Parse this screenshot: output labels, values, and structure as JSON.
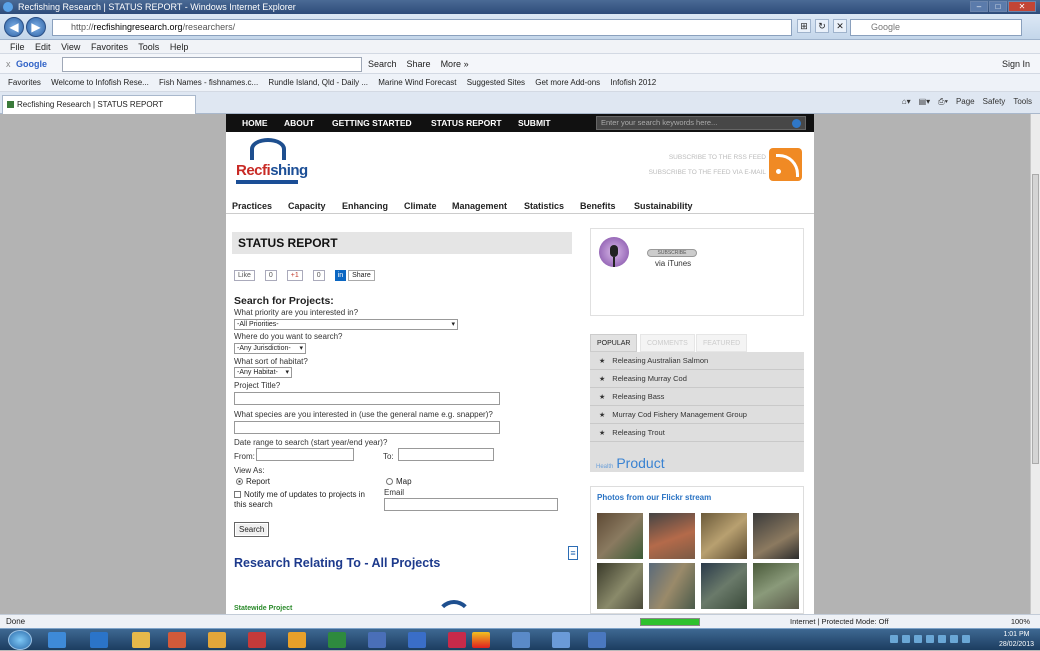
{
  "browser": {
    "title": "Recfishing Research | STATUS REPORT - Windows Internet Explorer",
    "address_prefix": "http://",
    "address_domain": "recfishingresearch.org",
    "address_path": "/researchers/",
    "google_search_placeholder": "Google",
    "menu": [
      "File",
      "Edit",
      "View",
      "Favorites",
      "Tools",
      "Help"
    ],
    "google_toolbar": {
      "close": "x",
      "logo": "Google",
      "items": [
        "Search",
        "Share",
        "More »"
      ],
      "right": "Sign In"
    },
    "favorites": [
      "Favorites",
      "Welcome to Infofish Rese...",
      "Fish Names - fishnames.c...",
      "Rundle Island, Qld - Daily ...",
      "Marine Wind Forecast",
      "Suggested Sites",
      "Get more Add-ons",
      "Infofish 2012"
    ],
    "tab_title": "Recfishing Research | STATUS REPORT",
    "commands": [
      "Page",
      "Safety",
      "Tools"
    ],
    "status_text": "Done",
    "zone_text": "Internet | Protected Mode: Off",
    "zoom_text": "100%",
    "clock_time": "1:01 PM",
    "clock_date": "28/02/2013"
  },
  "site": {
    "topnav": [
      "HOME",
      "ABOUT",
      "GETTING STARTED",
      "STATUS REPORT",
      "SUBMIT"
    ],
    "search_placeholder": "Enter your search keywords here...",
    "logo_word_a": "Recfi",
    "logo_word_b": "shing",
    "subscribe_rss": "SUBSCRIBE TO THE RSS FEED",
    "subscribe_email": "SUBSCRIBE TO THE FEED VIA E-MAIL",
    "categories": [
      "Practices",
      "Capacity",
      "Enhancing",
      "Climate",
      "Management",
      "Statistics",
      "Benefits",
      "Sustainability"
    ]
  },
  "main": {
    "heading": "STATUS REPORT",
    "like_label": "Like",
    "like_count": "0",
    "gplus_label": "+1",
    "gplus_count": "0",
    "linkedin_label": "in",
    "share_label": "Share",
    "form_title": "Search for Projects:",
    "q_priority": "What priority are you interested in?",
    "priority_value": "-All Priorities-",
    "q_where": "Where do you want to search?",
    "jurisdiction_value": "-Any Jurisdiction-",
    "q_habitat": "What sort of habitat?",
    "habitat_value": "-Any Habitat-",
    "q_title": "Project Title?",
    "q_species": "What species are you interested in (use the general name e.g. snapper)?",
    "q_date": "Date range to search (start year/end year)?",
    "from_label": "From:",
    "to_label": "To:",
    "view_as": "View As:",
    "opt_report": "Report",
    "opt_map": "Map",
    "notify_label": "Notify me of updates to projects in this search",
    "email_label": "Email",
    "search_button": "Search",
    "research_heading": "Research Relating To - All Projects",
    "statewide": "Statewide Project"
  },
  "sidebar": {
    "subscribe_btn": "SUBSCRIBE",
    "via_itunes": "via iTunes",
    "tabs": [
      "POPULAR",
      "COMMENTS",
      "FEATURED"
    ],
    "popular": [
      "Releasing Australian Salmon",
      "Releasing Murray Cod",
      "Releasing Bass",
      "Murray Cod Fishery Management Group",
      "Releasing Trout"
    ],
    "product_small": "Health",
    "product_big": "Product",
    "flickr_title": "Photos from our Flickr stream"
  }
}
